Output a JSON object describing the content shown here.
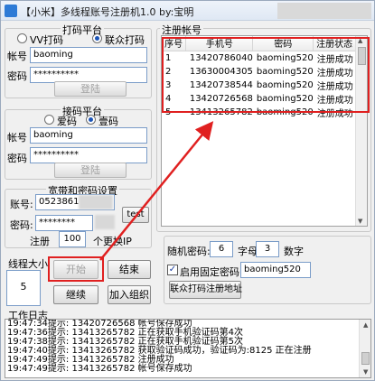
{
  "window": {
    "title": "【小米】多线程账号注册机1.0  by:宝明"
  },
  "coding_platform": {
    "title": "打码平台",
    "options": [
      "VV打码",
      "联众打码"
    ],
    "selected": 1,
    "account_label": "帐号",
    "account_value": "baoming",
    "password_label": "密码",
    "password_value": "**********",
    "login_label": "登陆"
  },
  "sms_platform": {
    "title": "接码平台",
    "options": [
      "爱码",
      "壹码"
    ],
    "selected": 1,
    "account_label": "帐号",
    "account_value": "baoming",
    "password_label": "密码",
    "password_value": "**********",
    "login_label": "登陆"
  },
  "broadband": {
    "title": "宽带和密码设置",
    "account_label": "账号:",
    "account_value": "0523861",
    "password_label": "密码:",
    "password_value": "********",
    "test_label": "test",
    "register_label": "注册",
    "register_value": "100",
    "register_suffix": "个更换IP"
  },
  "threads": {
    "title": "线程大小",
    "value": "5"
  },
  "actions": {
    "start_label": "开始",
    "end_label": "结束",
    "continue_label": "继续",
    "join_group_label": "加入组织"
  },
  "accounts": {
    "title": "注册帐号",
    "columns": [
      "序号",
      "手机号",
      "密码",
      "注册状态"
    ],
    "rows": [
      {
        "no": "1",
        "phone": "13420786040",
        "password": "baoming520",
        "status": "注册成功"
      },
      {
        "no": "2",
        "phone": "13630004305",
        "password": "baoming520",
        "status": "注册成功"
      },
      {
        "no": "3",
        "phone": "13420738544",
        "password": "baoming520",
        "status": "注册成功"
      },
      {
        "no": "4",
        "phone": "13420726568",
        "password": "baoming520",
        "status": "注册成功"
      },
      {
        "no": "5",
        "phone": "13413265782",
        "password": "baoming520",
        "status": "注册成功"
      }
    ]
  },
  "random_password": {
    "label": "随机密码:",
    "value1": "6",
    "letters_label": "字母",
    "value2": "3",
    "digits_label": "数字",
    "fixed_label": "启用固定密码:",
    "fixed_checked": true,
    "fixed_value": "baoming520",
    "register_url_label": "联众打码注册地址"
  },
  "log": {
    "title": "工作日志",
    "lines": [
      "19:47:34提示: 13420726568   帐号保存成功",
      "19:47:36提示: 13413265782   正在获取手机验证码第4次",
      "19:47:38提示: 13413265782   正在获取手机验证码第5次",
      "19:47:40提示: 13413265782   获取验证码成功，验证码为:8125  正在注册",
      "19:47:49提示: 13413265782   注册成功",
      "19:47:49提示: 13413265782   帐号保存成功"
    ]
  }
}
